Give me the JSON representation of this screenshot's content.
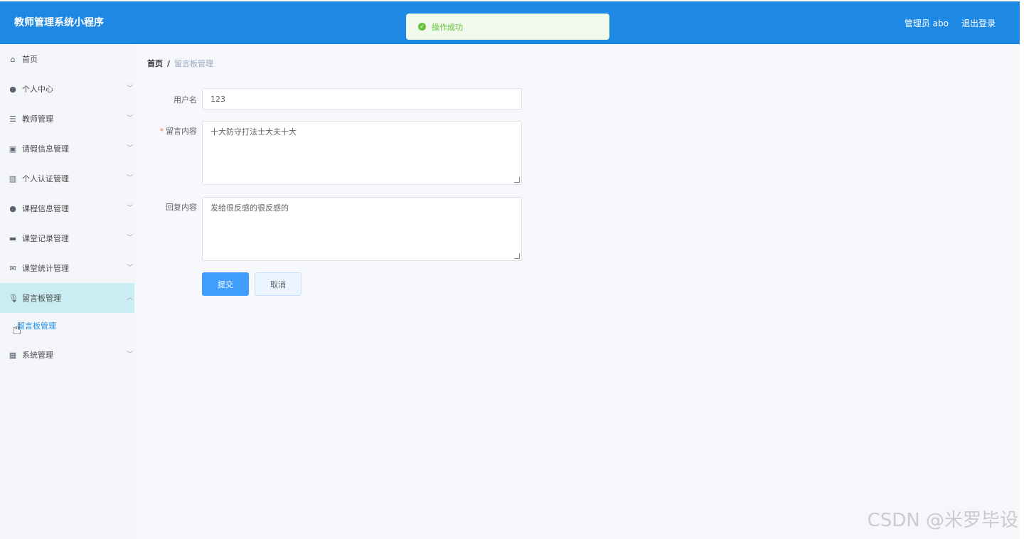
{
  "header": {
    "title": "教师管理系统小程序",
    "user_label": "管理员 abo",
    "logout_label": "退出登录",
    "color": "#1e88e5"
  },
  "toast": {
    "message": "操作成功",
    "icon": "check-circle-icon"
  },
  "sidebar": {
    "items": [
      {
        "label": "首页",
        "icon": "home-icon"
      },
      {
        "label": "个人中心",
        "icon": "user-icon"
      },
      {
        "label": "教师管理",
        "icon": "list-icon"
      },
      {
        "label": "请假信息管理",
        "icon": "clipboard-icon"
      },
      {
        "label": "个人认证管理",
        "icon": "chart-icon"
      },
      {
        "label": "课程信息管理",
        "icon": "user-icon"
      },
      {
        "label": "课堂记录管理",
        "icon": "monitor-icon"
      },
      {
        "label": "课堂统计管理",
        "icon": "mail-icon"
      },
      {
        "label": "留言板管理",
        "icon": "microphone-icon"
      },
      {
        "label": "系统管理",
        "icon": "grid-icon"
      }
    ],
    "submenu": {
      "label": "留言板管理"
    }
  },
  "breadcrumb": {
    "home": "首页",
    "separator": "/",
    "current": "留言板管理"
  },
  "form": {
    "username_label": "用户名",
    "username_value": "123",
    "message_label": "留言内容",
    "message_value": "十大防守打法士大夫十大",
    "reply_label": "回复内容",
    "reply_value": "发给很反感的很反感的",
    "submit_label": "提交",
    "cancel_label": "取消"
  },
  "watermark": "CSDN @米罗毕设"
}
